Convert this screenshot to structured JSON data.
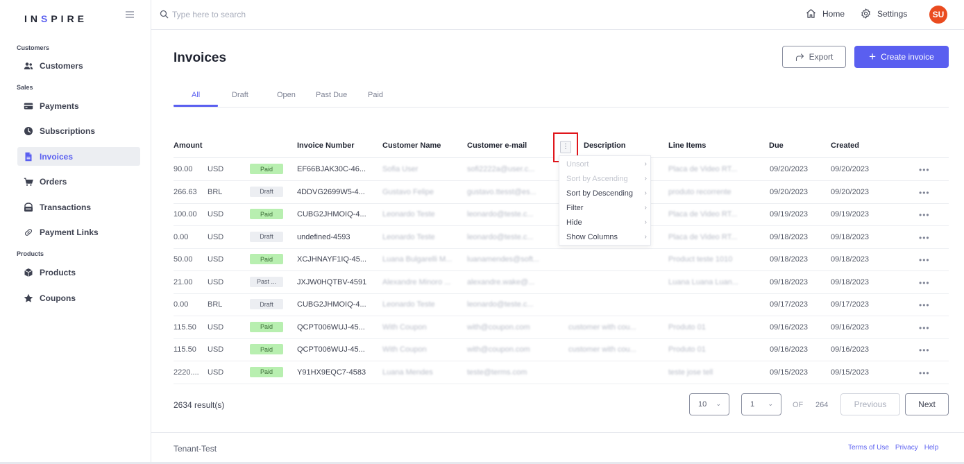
{
  "app": {
    "brand_prefix": "IN",
    "brand_accent": "S",
    "brand_suffix": "PIRE",
    "accent_color": "#5a5ff0"
  },
  "sidebar": {
    "sections": [
      {
        "label": "Customers"
      },
      {
        "label": "Sales"
      },
      {
        "label": "Products"
      }
    ],
    "items": [
      {
        "label": "Customers",
        "icon": "users-icon"
      },
      {
        "label": "Payments",
        "icon": "credit-card-icon"
      },
      {
        "label": "Subscriptions",
        "icon": "clock-icon"
      },
      {
        "label": "Invoices",
        "icon": "document-icon",
        "active": true
      },
      {
        "label": "Orders",
        "icon": "cart-icon"
      },
      {
        "label": "Transactions",
        "icon": "wallet-icon"
      },
      {
        "label": "Payment Links",
        "icon": "link-icon"
      },
      {
        "label": "Products",
        "icon": "box-icon"
      },
      {
        "label": "Coupons",
        "icon": "star-icon"
      }
    ]
  },
  "topbar": {
    "search_placeholder": "Type here to search",
    "home_label": "Home",
    "settings_label": "Settings",
    "avatar_initials": "SU"
  },
  "page": {
    "title": "Invoices",
    "export_label": "Export",
    "create_label": "Create invoice"
  },
  "tabs": [
    {
      "label": "All",
      "active": true
    },
    {
      "label": "Draft"
    },
    {
      "label": "Open"
    },
    {
      "label": "Past Due"
    },
    {
      "label": "Paid"
    }
  ],
  "table": {
    "headers": {
      "amount": "Amount",
      "invoice_number": "Invoice Number",
      "customer_name": "Customer Name",
      "customer_email": "Customer e-mail",
      "description": "Description",
      "line_items": "Line Items",
      "due": "Due",
      "created": "Created"
    },
    "rows": [
      {
        "amount": "90.00",
        "currency": "USD",
        "recurring": false,
        "status": "Paid",
        "status_type": "paid",
        "invoice": "EF66BJAK30C-46...",
        "name": "Sofia User",
        "email": "sofi2222a@user.c...",
        "description": "",
        "line_items": "Placa de Video RT...",
        "due": "09/20/2023",
        "created": "09/20/2023"
      },
      {
        "amount": "266.63",
        "currency": "BRL",
        "recurring": true,
        "status": "Draft",
        "status_type": "draft",
        "invoice": "4DDVG2699W5-4...",
        "name": "Gustavo Felipe",
        "email": "gustavo.ttesst@es...",
        "description": "",
        "line_items": "produto recorrente",
        "due": "09/20/2023",
        "created": "09/20/2023"
      },
      {
        "amount": "100.00",
        "currency": "USD",
        "recurring": true,
        "status": "Paid",
        "status_type": "paid",
        "invoice": "CUBG2JHMOIQ-4...",
        "name": "Leonardo Teste",
        "email": "leonardo@teste.c...",
        "description": "",
        "line_items": "Placa de Video RT...",
        "due": "09/19/2023",
        "created": "09/19/2023"
      },
      {
        "amount": "0.00",
        "currency": "USD",
        "recurring": false,
        "status": "Draft",
        "status_type": "draft",
        "invoice": "undefined-4593",
        "name": "Leonardo Teste",
        "email": "leonardo@teste.c...",
        "description": "",
        "line_items": "Placa de Video RT...",
        "due": "09/18/2023",
        "created": "09/18/2023"
      },
      {
        "amount": "50.00",
        "currency": "USD",
        "recurring": true,
        "status": "Paid",
        "status_type": "paid",
        "invoice": "XCJHNAYF1IQ-45...",
        "name": "Luana Bulgarelli M...",
        "email": "luanamendes@soft...",
        "description": "",
        "line_items": "Product teste 1010",
        "due": "09/18/2023",
        "created": "09/18/2023"
      },
      {
        "amount": "21.00",
        "currency": "USD",
        "recurring": true,
        "status": "Past ...",
        "status_type": "pastdue",
        "invoice": "JXJW0HQTBV-4591",
        "name": "Alexandre Minoro ...",
        "email": "alexandre.wake@...",
        "description": "",
        "line_items": "Luana Luana Luan...",
        "due": "09/18/2023",
        "created": "09/18/2023"
      },
      {
        "amount": "0.00",
        "currency": "BRL",
        "recurring": false,
        "status": "Draft",
        "status_type": "draft",
        "invoice": "CUBG2JHMOIQ-4...",
        "name": "Leonardo Teste",
        "email": "leonardo@teste.c...",
        "description": "",
        "line_items": "",
        "due": "09/17/2023",
        "created": "09/17/2023"
      },
      {
        "amount": "115.50",
        "currency": "USD",
        "recurring": true,
        "status": "Paid",
        "status_type": "paid",
        "invoice": "QCPT006WUJ-45...",
        "name": "With Coupon",
        "email": "with@coupon.com",
        "description": "customer with cou...",
        "line_items": "Produto 01",
        "due": "09/16/2023",
        "created": "09/16/2023"
      },
      {
        "amount": "115.50",
        "currency": "USD",
        "recurring": true,
        "status": "Paid",
        "status_type": "paid",
        "invoice": "QCPT006WUJ-45...",
        "name": "With Coupon",
        "email": "with@coupon.com",
        "description": "customer with cou...",
        "line_items": "Produto 01",
        "due": "09/16/2023",
        "created": "09/16/2023"
      },
      {
        "amount": "2220....",
        "currency": "USD",
        "recurring": true,
        "status": "Paid",
        "status_type": "paid",
        "invoice": "Y91HX9EQC7-4583",
        "name": "Luana Mendes",
        "email": "teste@terms.com",
        "description": "",
        "line_items": "teste jose tell",
        "due": "09/15/2023",
        "created": "09/15/2023"
      }
    ],
    "row_more_label": "•••"
  },
  "column_menu": {
    "button_label": "⋮",
    "items": [
      {
        "label": "Unsort",
        "disabled": true
      },
      {
        "label": "Sort by Ascending",
        "disabled": true
      },
      {
        "label": "Sort by Descending",
        "disabled": false
      },
      {
        "label": "Filter",
        "disabled": false
      },
      {
        "label": "Hide",
        "disabled": false
      },
      {
        "label": "Show Columns",
        "disabled": false
      }
    ]
  },
  "pagination": {
    "results_text": "2634 result(s)",
    "page_size": "10",
    "current_page": "1",
    "of_label": "OF",
    "total_pages": "264",
    "previous_label": "Previous",
    "next_label": "Next"
  },
  "footer": {
    "tenant": "Tenant-Test",
    "links": [
      "Terms of Use",
      "Privacy",
      "Help"
    ]
  }
}
